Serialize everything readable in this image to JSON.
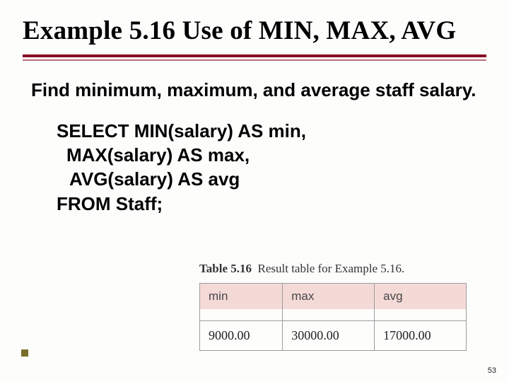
{
  "title": "Example 5.16  Use of MIN, MAX, AVG",
  "description": "Find minimum, maximum, and average staff salary.",
  "sql": {
    "line1": "SELECT MIN(salary) AS min,",
    "line2": "MAX(salary) AS max,",
    "line3": "AVG(salary) AS avg",
    "line4": "FROM Staff;"
  },
  "table": {
    "caption_label": "Table 5.16",
    "caption_text": "Result table for Example 5.16.",
    "headers": {
      "c1": "min",
      "c2": "max",
      "c3": "avg"
    },
    "row": {
      "c1": "9000.00",
      "c2": "30000.00",
      "c3": "17000.00"
    }
  },
  "page_number": "53",
  "chart_data": {
    "type": "table",
    "title": "Result table for Example 5.16.",
    "categories": [
      "min",
      "max",
      "avg"
    ],
    "values": [
      9000.0,
      30000.0,
      17000.0
    ]
  }
}
